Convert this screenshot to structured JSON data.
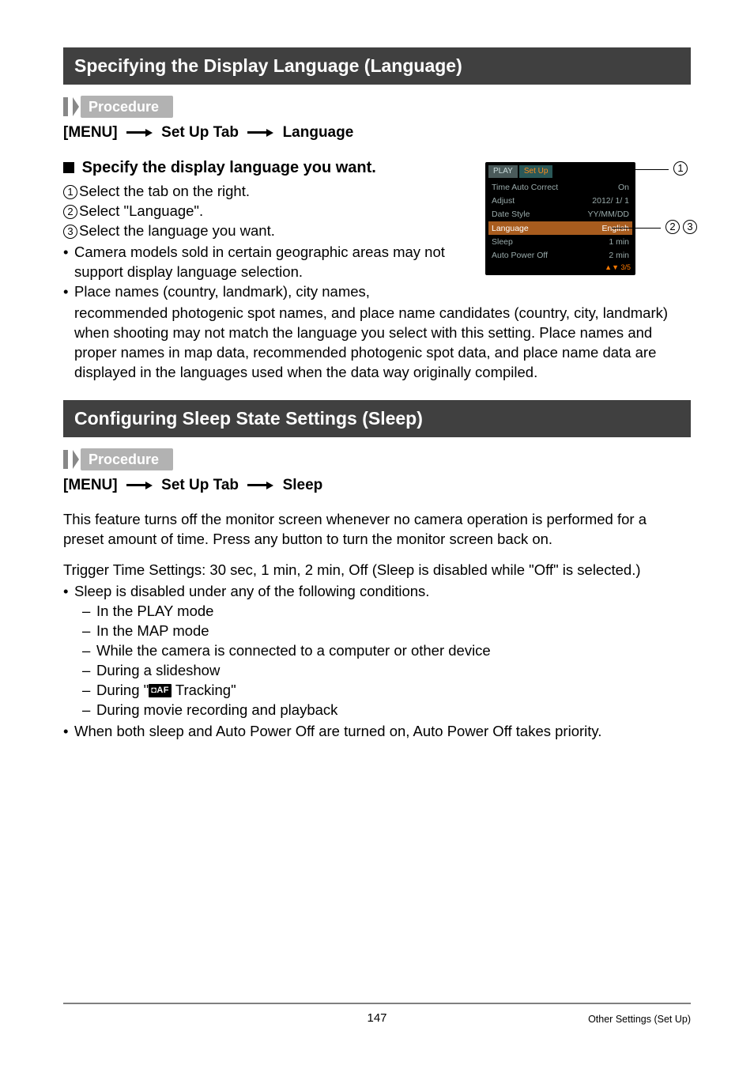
{
  "section1": {
    "title": "Specifying the Display Language (Language)",
    "procedure_label": "Procedure",
    "menu_path": {
      "p1": "[MENU]",
      "p2": "Set Up Tab",
      "p3": "Language"
    },
    "subhead": "Specify the display language you want.",
    "steps": {
      "s1": "Select the tab on the right.",
      "s2": "Select \"Language\".",
      "s3": "Select the language you want."
    },
    "bullets": {
      "b1": "Camera models sold in certain geographic areas may not support display language selection.",
      "b2_first": "Place names (country, landmark), city names,",
      "b2_rest": "recommended photogenic spot names, and place name candidates (country, city, landmark) when shooting may not match the language you select with this setting. Place names and proper names in map data, recommended photogenic spot data, and place name data are displayed in the languages used when the data way originally compiled."
    },
    "camera": {
      "tab1": "PLAY",
      "tab2": "Set Up",
      "rows": [
        {
          "l": "Time Auto Correct",
          "r": "On"
        },
        {
          "l": "Adjust",
          "r": "2012/  1/  1"
        },
        {
          "l": "Date Style",
          "r": "YY/MM/DD"
        },
        {
          "l": "Language",
          "r": "English"
        },
        {
          "l": "Sleep",
          "r": "1 min"
        },
        {
          "l": "Auto Power Off",
          "r": "2 min"
        }
      ],
      "footer": "▲▼ 3/5"
    },
    "callouts": {
      "c1": "1",
      "c2": "2",
      "c3": "3"
    }
  },
  "section2": {
    "title": "Configuring Sleep State Settings (Sleep)",
    "procedure_label": "Procedure",
    "menu_path": {
      "p1": "[MENU]",
      "p2": "Set Up Tab",
      "p3": "Sleep"
    },
    "para1": "This feature turns off the monitor screen whenever no camera operation is performed for a preset amount of time. Press any button to turn the monitor screen back on.",
    "para2": "Trigger Time Settings: 30 sec, 1 min, 2 min, Off (Sleep is disabled while \"Off\" is selected.)",
    "b1": "Sleep is disabled under any of the following conditions.",
    "dashes": {
      "d1": "In the PLAY mode",
      "d2": "In the MAP mode",
      "d3": "While the camera is connected to a computer or other device",
      "d4": "During a slideshow",
      "d5a": "During \"",
      "d5icon": "◘AF",
      "d5b": " Tracking\"",
      "d6": "During movie recording and playback"
    },
    "b2": "When both sleep and Auto Power Off are turned on, Auto Power Off takes priority."
  },
  "footer": {
    "page": "147",
    "right": "Other Settings (Set Up)"
  }
}
